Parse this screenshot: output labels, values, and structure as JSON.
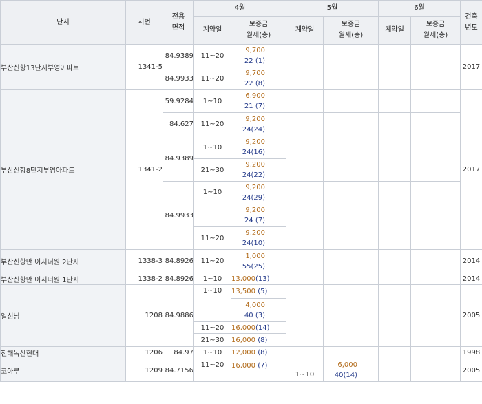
{
  "header": {
    "complex": "단지",
    "lot": "지번",
    "area_line1": "전용",
    "area_line2": "면적",
    "months": [
      "4월",
      "5월",
      "6월"
    ],
    "contract_date": "계약일",
    "deposit": "보증금",
    "monthly": "월세(층)",
    "year_line1": "건축",
    "year_line2": "년도"
  },
  "rows": [
    {
      "name": "부산신항13단지부영아파트",
      "lot": "1341-5",
      "area": "84.9389",
      "date": "11~20",
      "deposit": "9,700",
      "monthly": "22",
      "floor": "(1)",
      "year": "2017",
      "m5": false
    },
    {
      "name": "",
      "lot": "",
      "area": "84.9933",
      "date": "11~20",
      "deposit": "9,700",
      "monthly": "22",
      "floor": "(8)",
      "year": ""
    },
    {
      "name": "부산신항8단지부영아파트",
      "lot": "1341-2",
      "area": "59.9284",
      "date": "1~10",
      "deposit": "6,900",
      "monthly": "21",
      "floor": "(7)",
      "year": "2017"
    },
    {
      "area": "84.627",
      "date": "11~20",
      "deposit": "9,200",
      "monthly": "24",
      "floor": "(24)"
    },
    {
      "area": "84.9389",
      "date": "1~10",
      "deposit": "9,200",
      "monthly": "24",
      "floor": "(16)"
    },
    {
      "date": "21~30",
      "deposit": "9,200",
      "monthly": "24",
      "floor": "(22)"
    },
    {
      "area": "84.9933",
      "date": "1~10",
      "deposit": "9,200",
      "monthly": "24",
      "floor": "(29)"
    },
    {
      "date": "",
      "deposit": "9,200",
      "monthly": "24",
      "floor": "(7)"
    },
    {
      "date": "11~20",
      "deposit": "9,200",
      "monthly": "24",
      "floor": "(10)"
    },
    {
      "name": "부산신항만 이지더원 2단지",
      "lot": "1338-3",
      "area": "84.8926",
      "date": "11~20",
      "deposit": "1,000",
      "monthly": "55",
      "floor": "(25)",
      "year": "2014"
    },
    {
      "name": "부산신항만 이지더원 1단지",
      "lot": "1338-2",
      "area": "84.8926",
      "date": "1~10",
      "deposit": "13,000",
      "monthly": "",
      "floor": "(13)",
      "year": "2014"
    },
    {
      "name": "일신님",
      "lot": "1208",
      "area": "84.9886",
      "date": "1~10",
      "deposit": "13,500",
      "monthly": "",
      "floor": "(5)",
      "year": "2005"
    },
    {
      "date": "",
      "deposit": "4,000",
      "monthly": "40",
      "floor": "(3)"
    },
    {
      "date": "11~20",
      "deposit": "16,000",
      "monthly": "",
      "floor": "(14)"
    },
    {
      "date": "21~30",
      "deposit": "16,000",
      "monthly": "",
      "floor": "(8)"
    },
    {
      "name": "진해녹산현대",
      "lot": "1206",
      "area": "84.97",
      "date": "1~10",
      "deposit": "12,000",
      "monthly": "",
      "floor": "(8)",
      "year": "1998"
    },
    {
      "name": "코아루",
      "lot": "1209",
      "area": "84.7156",
      "date": "11~20",
      "deposit": "16,000",
      "monthly": "",
      "floor": "(7)",
      "year": "2005",
      "m5_date": "1~10",
      "m5_deposit": "6,000",
      "m5_monthly": "40",
      "m5_floor": "(14)"
    }
  ]
}
